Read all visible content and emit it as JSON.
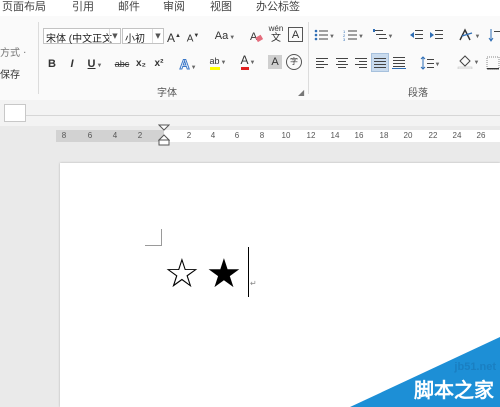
{
  "tabs": [
    "页面布局",
    "引用",
    "邮件",
    "审阅",
    "视图",
    "办公标签"
  ],
  "clipboard": {
    "format_painter_fragment": "方式 ·",
    "save_fragment": "保存"
  },
  "font": {
    "name": "宋体 (中文正文",
    "size": "小初",
    "grow_label": "A",
    "shrink_label": "A",
    "change_case_label": "Aa",
    "bold": "B",
    "italic": "I",
    "underline": "U",
    "strike": "abc",
    "subscript": "x₂",
    "superscript": "x²",
    "text_effect": "A",
    "highlight": "ab",
    "font_color": "A",
    "shading": "A",
    "enclose": "字",
    "phonetic_top": "wén",
    "phonetic_bottom": "文",
    "border_char": "A",
    "group_label": "字体"
  },
  "paragraph": {
    "group_label": "段落"
  },
  "ruler": {
    "left_ticks": [
      "8",
      "6",
      "4",
      "2"
    ],
    "right_ticks": [
      "2",
      "4",
      "6",
      "8",
      "10",
      "12",
      "14",
      "16",
      "18",
      "20",
      "22",
      "24",
      "26"
    ]
  },
  "document": {
    "symbols": [
      "☆",
      "★"
    ],
    "paragraph_mark": "↵"
  },
  "watermark": {
    "domain": "jb51.net",
    "brand": "脚本之家"
  },
  "colors": {
    "accent_blue": "#1d8fd6",
    "highlight_yellow": "#ffff00",
    "font_red": "#e02020"
  }
}
